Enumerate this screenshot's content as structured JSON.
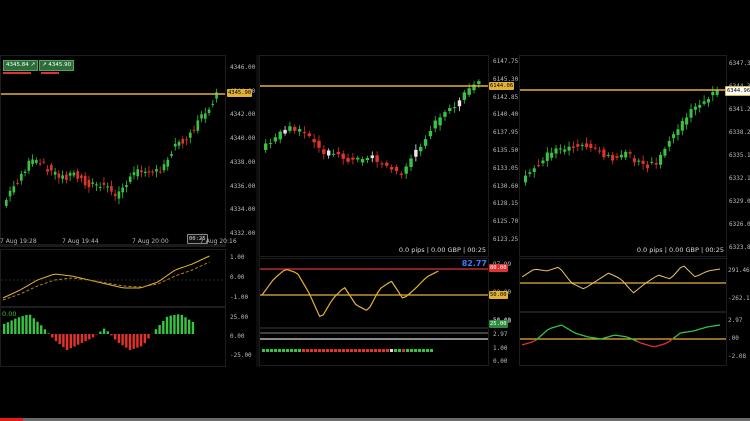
{
  "left_panel": {
    "order_buttons": {
      "sell": "4345.84",
      "buy": "4345.90"
    },
    "price_axis": [
      "4346.00",
      "4344.00",
      "4342.00",
      "4340.00",
      "4338.00",
      "4336.00",
      "4334.00",
      "4332.00"
    ],
    "current_price": "4345.90",
    "time_labels": [
      "7 Aug 19:28",
      "7 Aug 19:44",
      "7 Aug 20:00",
      "7 Aug 20:16"
    ],
    "countdown": "00:25",
    "osc1_axis": [
      "1.00",
      "0.00",
      "-1.00"
    ],
    "osc2_axis": [
      "25.00",
      "0.00",
      "-25.00"
    ],
    "osc2_value": "0.00"
  },
  "middle_panel": {
    "price_axis": [
      "6147.75",
      "6145.30",
      "6142.85",
      "6140.40",
      "6137.95",
      "6135.50",
      "6133.05",
      "6130.60",
      "6128.15",
      "6125.70",
      "6123.25"
    ],
    "current_price": "6144.06",
    "status": "0.0 pips | 0.00 GBP | 00:25",
    "rsi_value": "82.77",
    "rsi_axis": [
      "97.99",
      "80.00",
      "50.00"
    ],
    "rsi_flag_high": "80.00",
    "rsi_flag_low": "50.00",
    "osc3_axis": [
      "25.00",
      "2.97",
      "1.00",
      "0.00"
    ],
    "osc3_flag": "25.00"
  },
  "right_panel": {
    "price_axis": [
      "6347.35",
      "6344.30",
      "6341.25",
      "6338.20",
      "6335.15",
      "6332.10",
      "6329.05",
      "6326.00",
      "6323.85"
    ],
    "current_price": "6344.96",
    "status": "0.0 pips | 0.00 GBP | 00:25",
    "osc1_axis": [
      "291.4604",
      "-262.1001"
    ],
    "osc2_axis": [
      "2.97",
      ".00",
      "-2.08"
    ]
  },
  "video_progress": 0.03,
  "colors": {
    "bull": "#38c443",
    "bear": "#e4322b",
    "level": "#e2b237",
    "osc_line": "#e2b237",
    "rsi_value": "#3a7bff"
  }
}
